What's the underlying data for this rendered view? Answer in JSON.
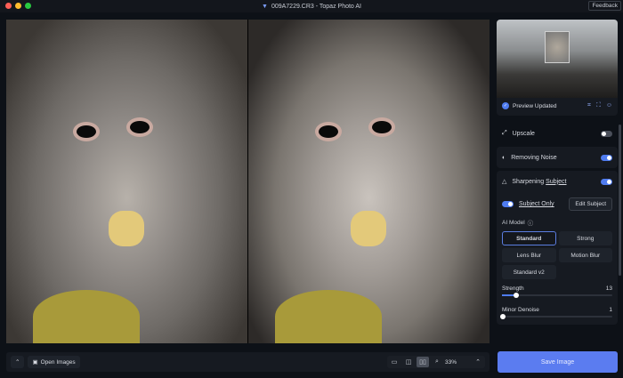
{
  "window": {
    "title": "009A7229.CR3 - Topaz Photo AI",
    "feedback": "Feedback"
  },
  "preview": {
    "status": "Preview Updated"
  },
  "panel": {
    "upscale": {
      "label": "Upscale",
      "enabled": false
    },
    "noise": {
      "label": "Removing Noise",
      "enabled": true
    },
    "sharpen": {
      "label_prefix": "Sharpening ",
      "label_subject": "Subject",
      "enabled": true,
      "subject_only": "Subject Only",
      "subject_only_enabled": true,
      "edit_subject": "Edit Subject",
      "ai_model_label": "AI Model",
      "models": [
        "Standard",
        "Strong",
        "Lens Blur",
        "Motion Blur",
        "Standard v2"
      ],
      "selected_model": "Standard",
      "strength": {
        "label": "Strength",
        "value": "13",
        "fraction": 0.13
      },
      "minor_denoise": {
        "label": "Minor Denoise",
        "value": "1",
        "fraction": 0.01
      }
    }
  },
  "bottom": {
    "open_images": "Open Images",
    "zoom": "33%"
  },
  "save": "Save Image",
  "colors": {
    "accent": "#5b7cf0",
    "bg": "#0d1117"
  }
}
